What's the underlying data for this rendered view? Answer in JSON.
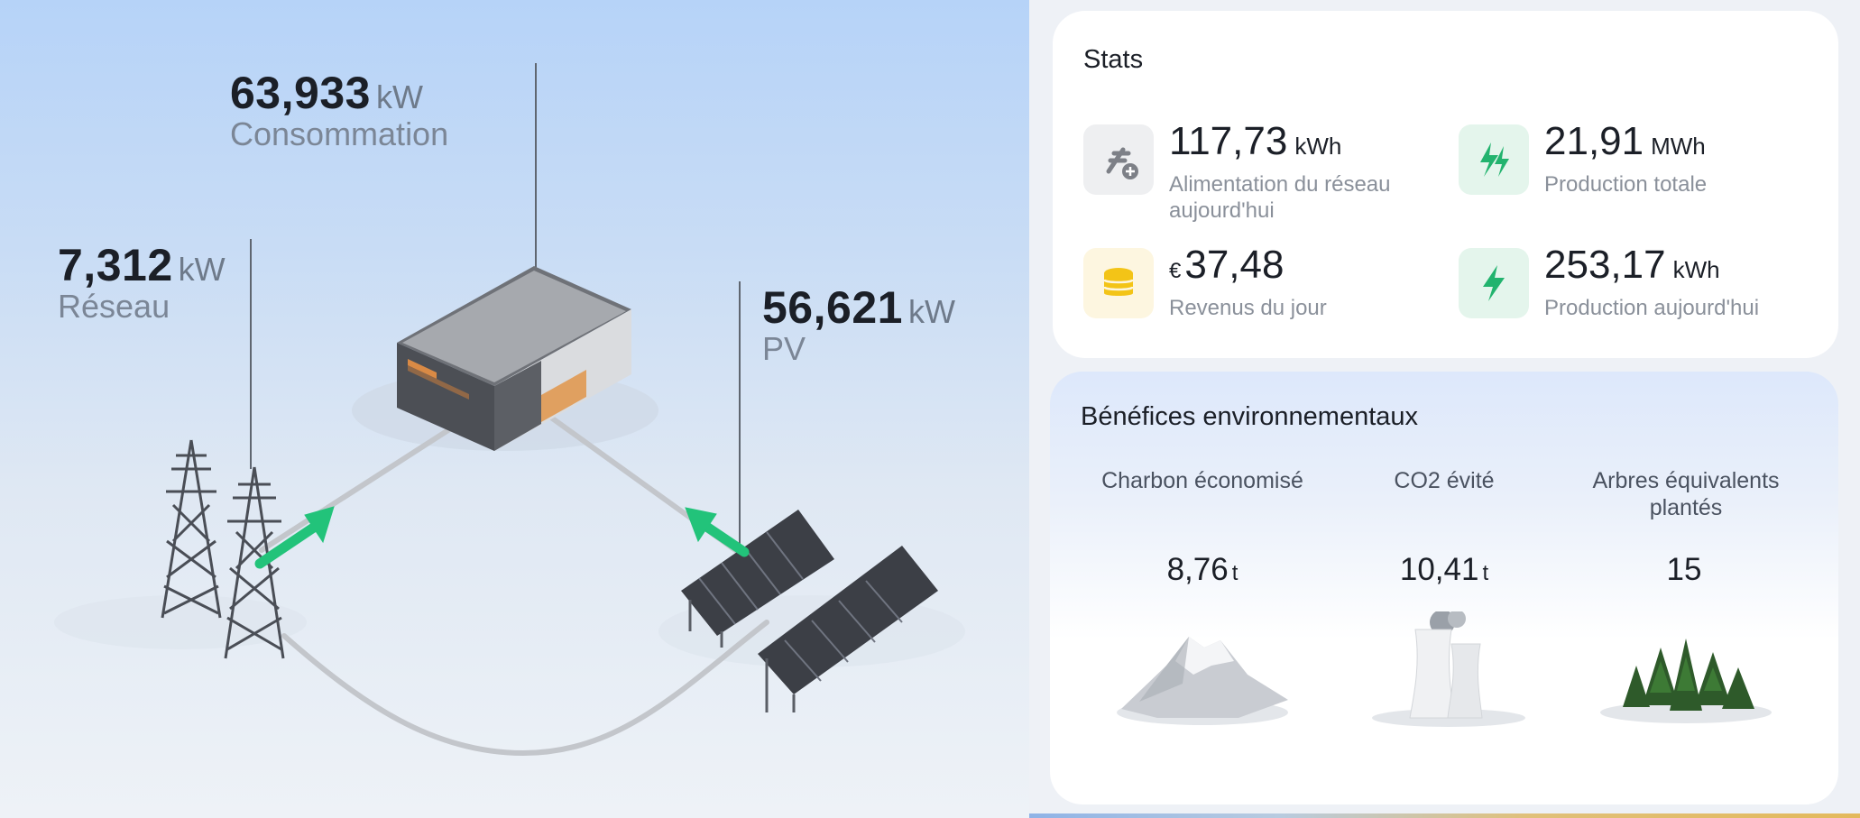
{
  "flow": {
    "consumption": {
      "value": "63,933",
      "unit": "kW",
      "label": "Consommation"
    },
    "grid": {
      "value": "7,312",
      "unit": "kW",
      "label": "Réseau"
    },
    "pv": {
      "value": "56,621",
      "unit": "kW",
      "label": "PV"
    },
    "arrow_color": "#22c37a"
  },
  "stats": {
    "title": "Stats",
    "items": [
      {
        "value": "117,73",
        "unit": "kWh",
        "label": "Alimentation du réseau aujourd'hui",
        "icon": "grid-plug-plus-icon"
      },
      {
        "value": "21,91",
        "unit": "MWh",
        "label": "Production totale",
        "icon": "double-bolt-icon"
      },
      {
        "currency": "€",
        "value": "37,48",
        "label": "Revenus du jour",
        "icon": "coin-stack-icon"
      },
      {
        "value": "253,17",
        "unit": "kWh",
        "label": "Production aujourd'hui",
        "icon": "bolt-icon"
      }
    ]
  },
  "environment": {
    "title": "Bénéfices environnementaux",
    "items": [
      {
        "label": "Charbon économisé",
        "value": "8,76",
        "unit": "t",
        "icon": "coal-mountain-icon"
      },
      {
        "label": "CO2 évité",
        "value": "10,41",
        "unit": "t",
        "icon": "cooling-tower-icon"
      },
      {
        "label": "Arbres équivalents plantés",
        "value": "15",
        "unit": "",
        "icon": "forest-icon"
      }
    ]
  },
  "colors": {
    "accent_green": "#22c37a",
    "coin_yellow": "#f3c417",
    "gray_icon": "#7d8087"
  }
}
